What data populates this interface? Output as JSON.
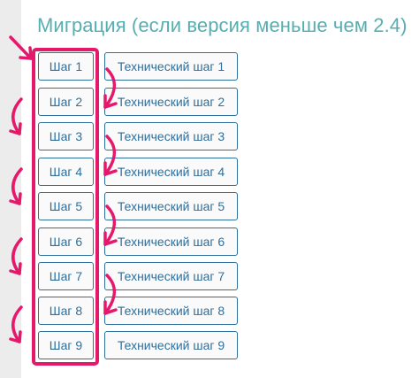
{
  "header": {
    "title": "Миграция (если версия меньше чем 2.4)"
  },
  "steps": [
    {
      "label": "Шаг 1",
      "tech_label": "Технический шаг 1"
    },
    {
      "label": "Шаг 2",
      "tech_label": "Технический шаг 2"
    },
    {
      "label": "Шаг 3",
      "tech_label": "Технический шаг 3"
    },
    {
      "label": "Шаг 4",
      "tech_label": "Технический шаг 4"
    },
    {
      "label": "Шаг 5",
      "tech_label": "Технический шаг 5"
    },
    {
      "label": "Шаг 6",
      "tech_label": "Технический шаг 6"
    },
    {
      "label": "Шаг 7",
      "tech_label": "Технический шаг 7"
    },
    {
      "label": "Шаг 8",
      "tech_label": "Технический шаг 8"
    },
    {
      "label": "Шаг 9",
      "tech_label": "Технический шаг 9"
    }
  ],
  "colors": {
    "title": "#57aeb2",
    "button_text": "#2f6f9c",
    "button_border": "#2f6f9c",
    "annotation": "#e5186b",
    "sidebar_strip": "#ececec"
  },
  "annotations": {
    "highlight": "step-column-highlight",
    "arrow_icons": "hand-drawn-arrow-icon"
  }
}
